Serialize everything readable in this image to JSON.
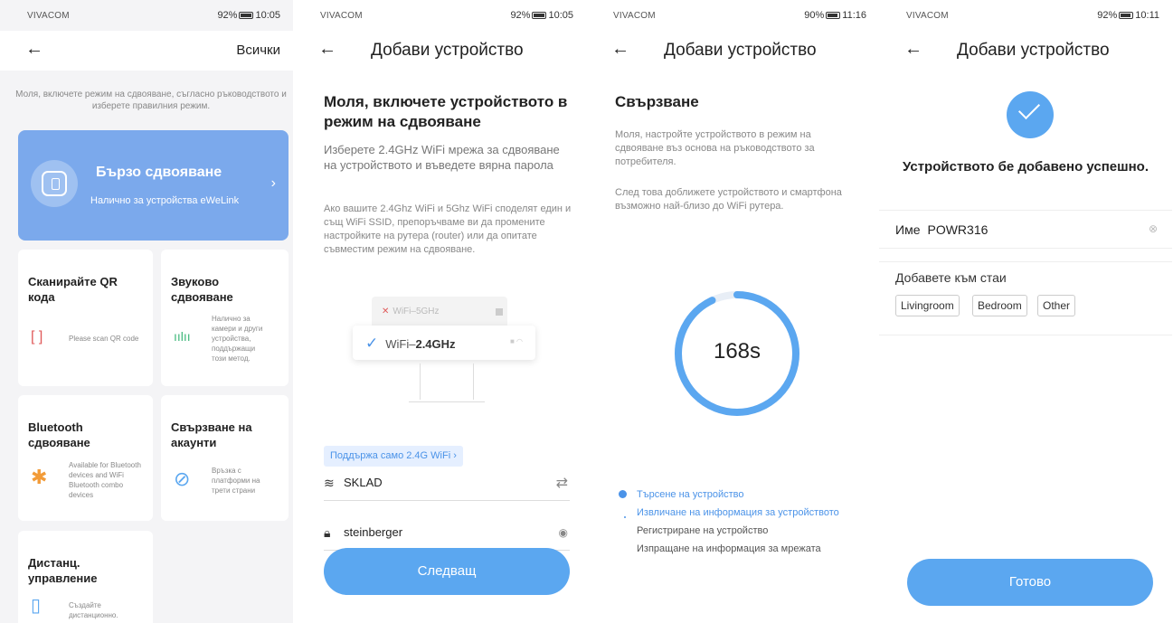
{
  "screen1": {
    "status": {
      "carrier": "VIVACOM",
      "battery": "92%",
      "time": "10:05"
    },
    "header": {
      "back": "←",
      "right_link": "Всички"
    },
    "instruction": "Моля, включете режим на сдвояване, съгласно ръководството и изберете правилния режим.",
    "quick_pair": {
      "title": "Бързо сдвояване",
      "subtitle": "Налично за устройства eWeLink",
      "chevron": "›"
    },
    "cards": {
      "qr": {
        "title": "Сканирайте QR кода",
        "desc": "Please scan QR code",
        "icon": "[ ]"
      },
      "sound": {
        "title": "Звуково сдвояване",
        "desc": "Налично за камери и други устройства, поддържащи този метод.",
        "icon": "ıılıı"
      },
      "bluetooth": {
        "title": "Bluetooth сдвояване",
        "desc": "Available for Bluetooth devices and WiFi Bluetooth combo devices",
        "icon": "✱"
      },
      "accounts": {
        "title": "Свързване на акаунти",
        "desc": "Връзка с платформи на трети страни",
        "icon": "⊘"
      },
      "remote": {
        "title": "Дистанц. управление",
        "desc": "Създайте дистанционно.",
        "icon": "▯"
      }
    }
  },
  "screen2": {
    "status": {
      "carrier": "VIVACOM",
      "battery": "92%",
      "time": "10:05"
    },
    "header": {
      "back": "←",
      "title": "Добави устройство"
    },
    "heading": "Моля, включете устройството в режим на сдвояване",
    "subheading": "Изберете 2.4GHz WiFi мрежа за сдвояване на устройството и въведете вярна парола",
    "note": "Ако вашите 2.4Ghz WiFi и 5Ghz WiFi споделят един и същ WiFi SSID, препоръчваме ви да промените настройките на рутера (router) или да опитате съвместим режим на сдвояване.",
    "illustration": {
      "wifi5": "WiFi–5GHz",
      "wifi24_prefix": "WiFi–",
      "wifi24_band": "2.4GHz"
    },
    "badge": "Поддържа само 2.4G WiFi ›",
    "ssid": "SKLAD",
    "password": "steinberger",
    "next_button": "Следващ"
  },
  "screen3": {
    "status": {
      "carrier": "VIVACOM",
      "battery": "90%",
      "time": "11:16"
    },
    "header": {
      "back": "←",
      "title": "Добави устройство"
    },
    "title": "Свързване",
    "p1": "Моля, настройте устройството в режим на сдвояване въз основа на ръководството за потребителя.",
    "p2": "След това доближете устройството и смартфона възможно най-близо до WiFi рутера.",
    "countdown": "168s",
    "progress_fraction": 0.93,
    "steps": [
      {
        "label": "Търсене на устройство",
        "state": "done"
      },
      {
        "label": "Извличане на информация за устройството",
        "state": "active"
      },
      {
        "label": "Регистриране на устройство",
        "state": "pending"
      },
      {
        "label": "Изпращане на информация за мрежата",
        "state": "pending"
      }
    ]
  },
  "screen4": {
    "status": {
      "carrier": "VIVACOM",
      "battery": "92%",
      "time": "10:11"
    },
    "header": {
      "back": "←",
      "title": "Добави устройство"
    },
    "success_message": "Устройството бе добавено успешно.",
    "name_label": "Име",
    "name_value": "POWR316",
    "rooms_label": "Добавете към стаи",
    "rooms": [
      "Livingroom",
      "Bedroom",
      "Other"
    ],
    "done_button": "Готово"
  },
  "colors": {
    "accent": "#5ba7f0",
    "card_blue": "#7ba9ec",
    "icon_orange": "#f29b38"
  }
}
